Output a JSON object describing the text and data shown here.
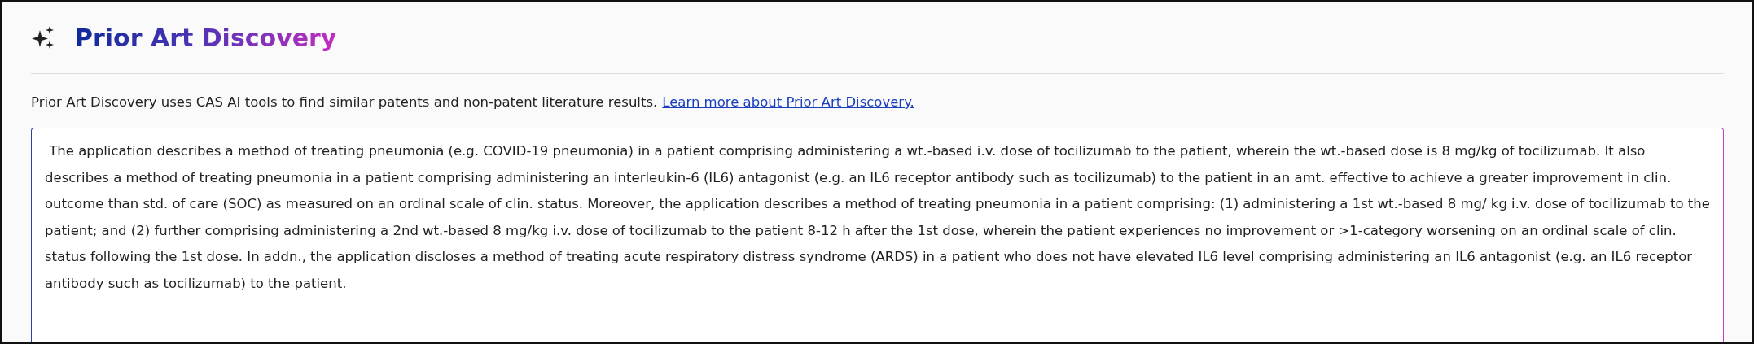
{
  "header": {
    "title": "Prior Art Discovery"
  },
  "intro": {
    "text": "Prior Art Discovery uses CAS AI tools to find similar patents and non-patent literature results.",
    "link": "Learn more about Prior Art Discovery."
  },
  "query_field": {
    "value": " The application describes a method of treating pneumonia (e.g. COVID-19 pneumonia) in a patient comprising administering a wt.-based i.v. dose of tocilizumab to the patient, wherein the wt.-based dose is 8 mg/kg of tocilizumab. It also describes a method of treating pneumonia in a patient comprising administering an interleukin-6 (IL6) antagonist (e.g. an IL6 receptor antibody such as tocilizumab) to the patient in an amt. effective to achieve a greater improvement in clin. outcome than std. of care (SOC) as measured on an ordinal scale of clin. status. Moreover, the application describes a method of treating pneumonia in a patient comprising: (1) administering a 1st wt.-based 8 mg/ kg i.v. dose of tocilizumab to the patient; and (2) further comprising administering a 2nd wt.-based 8 mg/kg i.v. dose of tocilizumab to the patient 8-12 h after the 1st dose, wherein the patient experiences no improvement or >1-category worsening on an ordinal scale of clin. status following the 1st dose. In addn., the application discloses a method of treating acute respiratory distress syndrome (ARDS) in a patient who does not have elevated IL6 level comprising administering an IL6 antagonist (e.g. an IL6 receptor antibody such as tocilizumab) to the patient."
  }
}
